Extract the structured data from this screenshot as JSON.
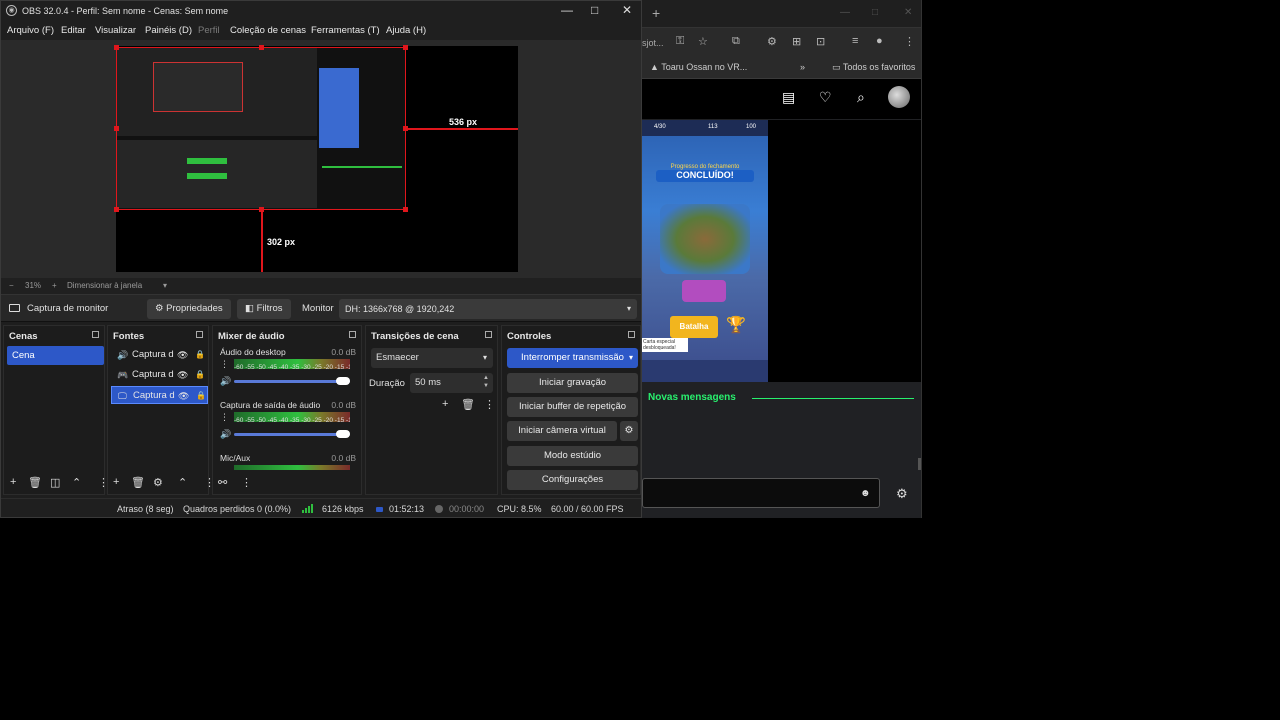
{
  "obs": {
    "window_title": "OBS 32.0.4 - Perfil: Sem nome - Cenas: Sem nome",
    "menu": [
      "Arquivo (F)",
      "Editar",
      "Visualizar",
      "Painéis (D)",
      "Perfil",
      "Coleção de cenas",
      "Ferramentas (T)",
      "Ajuda (H)"
    ],
    "preview": {
      "guide_right_label": "536 px",
      "guide_bottom_label": "302 px",
      "zoom": "31%",
      "zoom_mode": "Dimensionar à janela"
    },
    "source_bar": {
      "source_name": "Captura de monitor",
      "properties_label": "Propriedades",
      "filters_label": "Filtros",
      "monitor_label": "Monitor",
      "monitor_value": "DH: 1366x768 @ 1920,242"
    },
    "scenes": {
      "title": "Cenas",
      "items": [
        "Cena"
      ]
    },
    "sources": {
      "title": "Fontes",
      "items": [
        {
          "name": "Captura d",
          "icon": "speaker-icon"
        },
        {
          "name": "Captura d",
          "icon": "gamepad-icon"
        },
        {
          "name": "Captura d",
          "icon": "monitor-icon"
        }
      ]
    },
    "mixer": {
      "title": "Mixer de áudio",
      "scale": "-60 -55 -50 -45 -40 -35 -30 -25 -20 -15 -10 -5 0",
      "channels": [
        {
          "name": "Áudio do desktop",
          "db": "0.0 dB"
        },
        {
          "name": "Captura de saída de áudio",
          "db": "0.0 dB"
        },
        {
          "name": "Mic/Aux",
          "db": "0.0 dB"
        }
      ]
    },
    "transitions": {
      "title": "Transições de cena",
      "selected": "Esmaecer",
      "duration_label": "Duração",
      "duration_value": "50 ms"
    },
    "controls": {
      "title": "Controles",
      "stream": "Interromper transmissão",
      "record": "Iniciar gravação",
      "replay": "Iniciar buffer de repetição",
      "virtual_cam": "Iniciar câmera virtual",
      "studio": "Modo estúdio",
      "settings": "Configurações"
    },
    "status": {
      "delay": "Atraso (8 seg)",
      "dropped": "Quadros perdidos 0 (0.0%)",
      "bitrate": "6126 kbps",
      "stream_time": "01:52:13",
      "rec_time": "00:00:00",
      "cpu": "CPU: 8.5%",
      "fps": "60.00 / 60.00 FPS"
    }
  },
  "browser": {
    "url_fragment": "sjot...",
    "bookmark": "Toaru Ossan no VR...",
    "all_favorites": "Todos os favoritos",
    "game": {
      "top_left": "4/30",
      "top_mid": "113",
      "top_right": "100",
      "progress_title": "Progresso do fechamento",
      "completed": "CONCLUÍDO!",
      "battle": "Batalha",
      "special": "Carta especial desbloqueada!"
    },
    "chat": {
      "new_messages": "Novas mensagens"
    }
  }
}
